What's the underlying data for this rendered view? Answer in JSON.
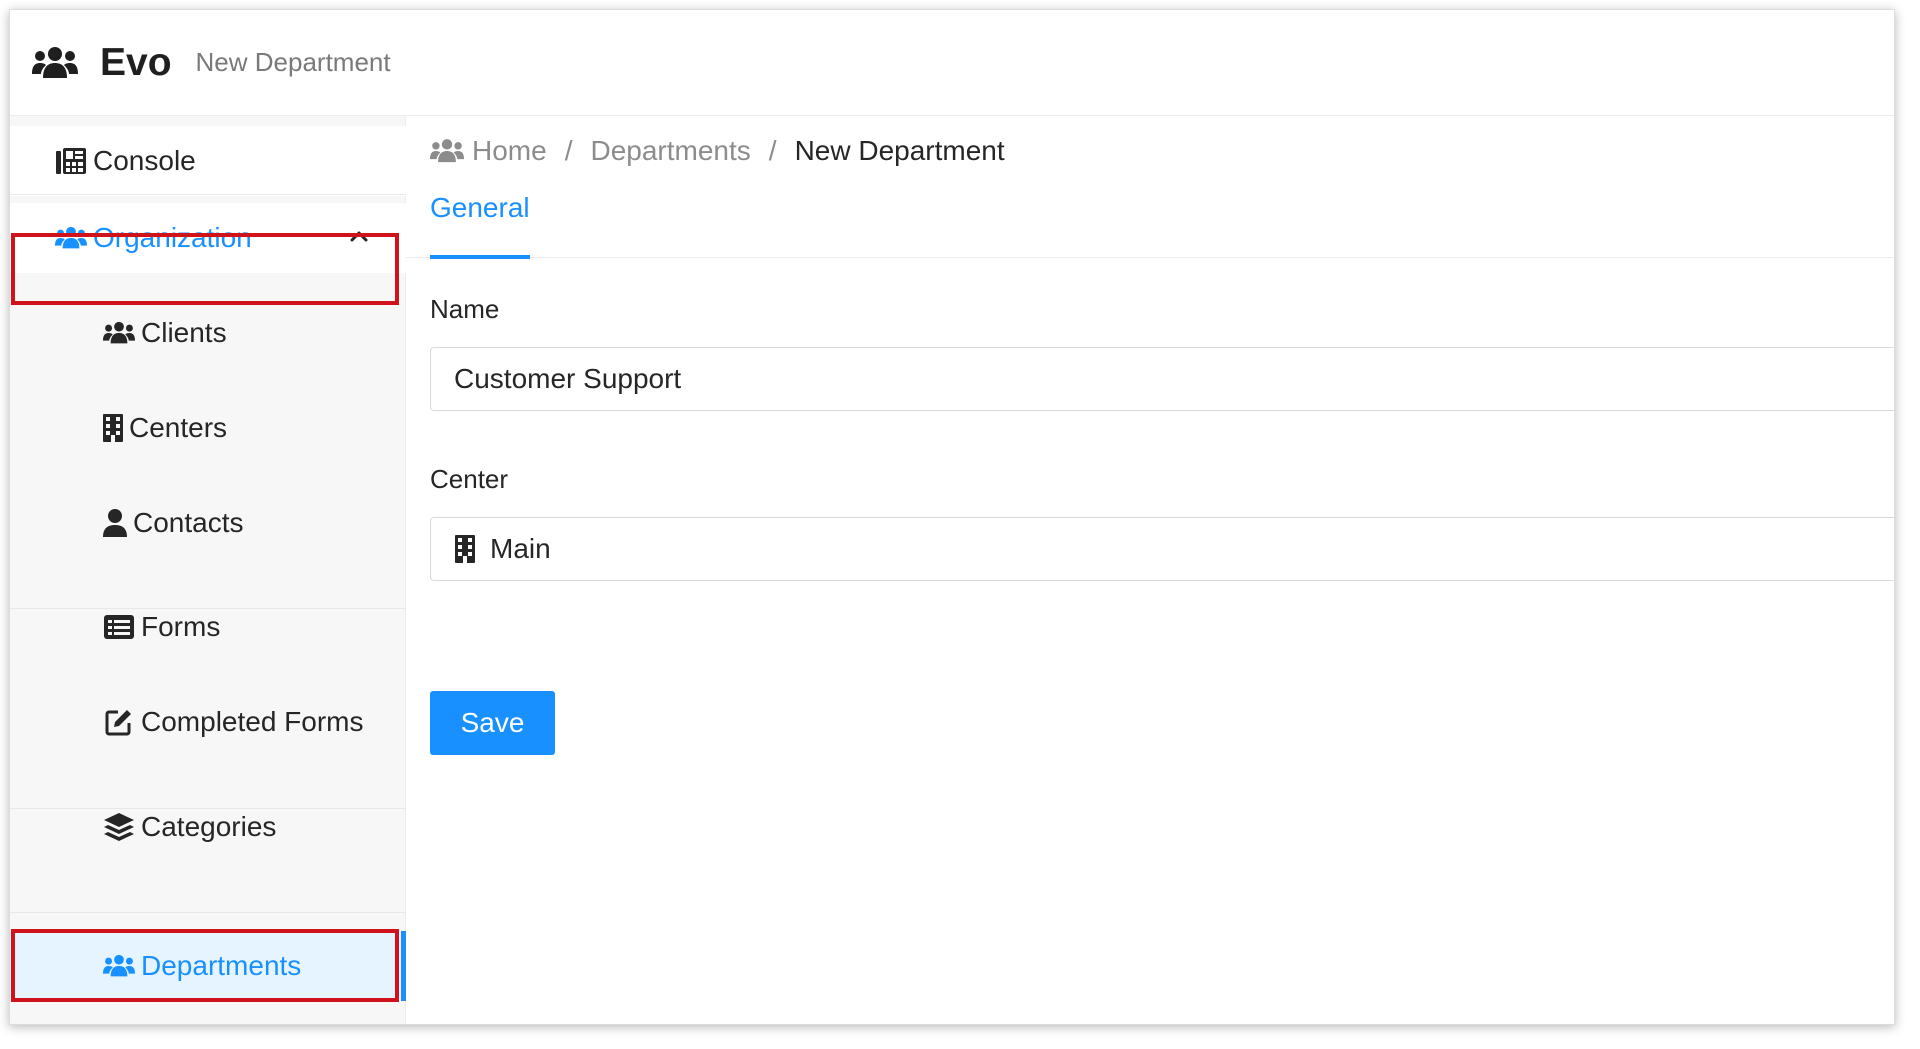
{
  "header": {
    "logo_icon": "users-icon",
    "app_name": "Evo",
    "page_name": "New Department"
  },
  "sidebar": {
    "items": [
      {
        "label": "Console",
        "icon": "console-icon"
      },
      {
        "label": "Organization",
        "icon": "users-icon",
        "expanded": true,
        "toggle_icon": "chevron-up-icon"
      },
      {
        "label": "Clients",
        "icon": "users-icon"
      },
      {
        "label": "Centers",
        "icon": "building-icon"
      },
      {
        "label": "Contacts",
        "icon": "user-icon"
      },
      {
        "label": "Forms",
        "icon": "list-icon"
      },
      {
        "label": "Completed Forms",
        "icon": "edit-icon"
      },
      {
        "label": "Categories",
        "icon": "layers-icon"
      },
      {
        "label": "Departments",
        "icon": "users-icon",
        "active": true
      }
    ]
  },
  "breadcrumb": {
    "icon": "users-icon",
    "items": [
      "Home",
      "Departments",
      "New Department"
    ],
    "separator": "/"
  },
  "tabs": [
    {
      "label": "General",
      "active": true
    }
  ],
  "form": {
    "name_label": "Name",
    "name_value": "Customer Support",
    "center_label": "Center",
    "center_icon": "building-icon",
    "center_value": "Main",
    "save_label": "Save"
  },
  "colors": {
    "accent": "#1890ff",
    "highlight_box": "#d0121b",
    "active_bg": "#e6f4ff",
    "sidebar_bg": "#f7f7f7"
  }
}
